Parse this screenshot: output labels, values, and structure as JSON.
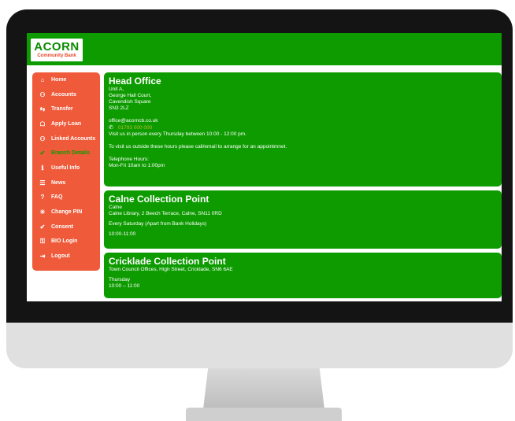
{
  "brand": {
    "name": "ACORN",
    "tagline": "Community Bank"
  },
  "nav": [
    {
      "icon": "home-icon",
      "glyph": "⌂",
      "label": "Home"
    },
    {
      "icon": "accounts-icon",
      "glyph": "⚇",
      "label": "Accounts"
    },
    {
      "icon": "transfer-icon",
      "glyph": "⇆",
      "label": "Transfer"
    },
    {
      "icon": "loan-icon",
      "glyph": "☖",
      "label": "Apply Loan"
    },
    {
      "icon": "linked-accounts-icon",
      "glyph": "⚇",
      "label": "Linked Accounts"
    },
    {
      "icon": "branch-icon",
      "glyph": "✔",
      "label": "Branch Details"
    },
    {
      "icon": "info-icon",
      "glyph": "ℹ",
      "label": "Useful Info"
    },
    {
      "icon": "news-icon",
      "glyph": "☰",
      "label": "News"
    },
    {
      "icon": "faq-icon",
      "glyph": "?",
      "label": "FAQ"
    },
    {
      "icon": "pin-icon",
      "glyph": "✳",
      "label": "Change PIN"
    },
    {
      "icon": "consent-icon",
      "glyph": "✔",
      "label": "Consent"
    },
    {
      "icon": "lock-icon",
      "glyph": "⚿",
      "label": "BIO Login"
    },
    {
      "icon": "logout-icon",
      "glyph": "⇥",
      "label": "Logout"
    }
  ],
  "head_office": {
    "title": "Head Office",
    "address": [
      "Unit A,",
      "George Hall Court,",
      "Cavendish Square",
      "SN3 2LZ"
    ],
    "email": "office@acorncb.co.uk",
    "phone": "01793 000 000",
    "visit": "Visit us in person every Thursday between 10:00 - 12:00 pm.",
    "appointment": "To visit us outside these hours please call/email to arrange for an appointmnet.",
    "hours_label": "Telephone Hours:",
    "hours": "Mon-Fri 10am to 1:00pm"
  },
  "calne": {
    "title": "Calne Collection Point",
    "town": "Calne",
    "address": "Calne Library, 2 Beech Terrace, Calne, SN11 0RD",
    "schedule": "Every Saturday (Apart from Bank Holidays)",
    "time": "10:00-11:00"
  },
  "cricklade": {
    "title": "Cricklade Collection Point",
    "address": "Town Council Offices, High Street, Cricklade, SN6 6AE",
    "day": "Thursday",
    "time": "10:00 – 11:00"
  }
}
